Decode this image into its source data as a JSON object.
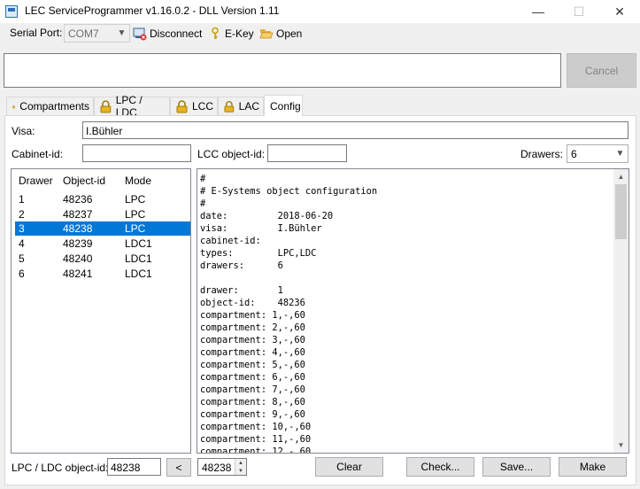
{
  "window": {
    "title": "LEC ServiceProgrammer v1.16.0.2 - DLL Version 1.11",
    "minimize": "—",
    "maximize": "☐",
    "close": "✕"
  },
  "toolbar": {
    "serial_port_label": "Serial Port:",
    "serial_port_value": "COM7",
    "disconnect_label": "Disconnect",
    "ekey_label": "E-Key",
    "open_label": "Open"
  },
  "status": {
    "cancel_label": "Cancel"
  },
  "tabs": [
    {
      "label": "Compartments"
    },
    {
      "label": "LPC / LDC"
    },
    {
      "label": "LCC"
    },
    {
      "label": "LAC"
    },
    {
      "label": "Config"
    }
  ],
  "config": {
    "visa_label": "Visa:",
    "visa_value": "I.Bühler",
    "cabinet_label": "Cabinet-id:",
    "cabinet_value": "",
    "lcc_label": "LCC object-id:",
    "lcc_value": "",
    "drawers_label": "Drawers:",
    "drawers_value": "6",
    "list": {
      "headers": [
        "Drawer",
        "Object-id",
        "Mode"
      ],
      "rows": [
        [
          "1",
          "48236",
          "LPC"
        ],
        [
          "2",
          "48237",
          "LPC"
        ],
        [
          "3",
          "48238",
          "LPC"
        ],
        [
          "4",
          "48239",
          "LDC1"
        ],
        [
          "5",
          "48240",
          "LDC1"
        ],
        [
          "6",
          "48241",
          "LDC1"
        ]
      ]
    },
    "config_text": "#\n# E-Systems object configuration\n#\ndate:         2018-06-20\nvisa:         I.Bühler\ncabinet-id:\ntypes:        LPC,LDC\ndrawers:      6\n\ndrawer:       1\nobject-id:    48236\ncompartment: 1,-,60\ncompartment: 2,-,60\ncompartment: 3,-,60\ncompartment: 4,-,60\ncompartment: 5,-,60\ncompartment: 6,-,60\ncompartment: 7,-,60\ncompartment: 8,-,60\ncompartment: 9,-,60\ncompartment: 10,-,60\ncompartment: 11,-,60\ncompartment: 12,-,60",
    "object_id_label": "LPC / LDC object-id:",
    "object_id_value": "48238",
    "prev_label": "<",
    "spin_value": "48238",
    "clear_label": "Clear",
    "check_label": "Check...",
    "save_label": "Save...",
    "make_label": "Make"
  }
}
